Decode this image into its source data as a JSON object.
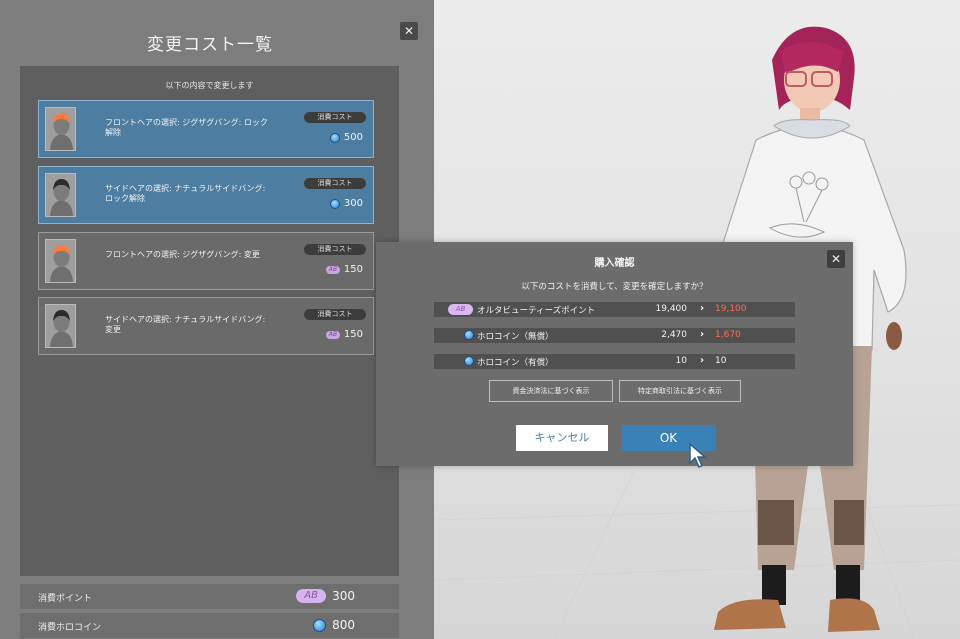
{
  "left_panel": {
    "title": "変更コスト一覧",
    "close_glyph": "✕",
    "caption": "以下の内容で変更します",
    "items": [
      {
        "text": "フロントヘアの選択: ジグザグバング: ロック解除",
        "tag": "消費コスト",
        "currency_icon": "holocoin-icon",
        "price": "500",
        "selected": true,
        "hair_color": "#ff7a3c"
      },
      {
        "text": "サイドヘアの選択: ナチュラルサイドバング: ロック解除",
        "tag": "消費コスト",
        "currency_icon": "holocoin-icon",
        "price": "300",
        "selected": true,
        "hair_color": "#2b2b2b"
      },
      {
        "text": "フロントヘアの選択: ジグザグバング: 変更",
        "tag": "消費コスト",
        "currency_icon": "altabeauties-point-icon",
        "price": "150",
        "selected": false,
        "hair_color": "#ff7a3c"
      },
      {
        "text": "サイドヘアの選択: ナチュラルサイドバング: 変更",
        "tag": "消費コスト",
        "currency_icon": "altabeauties-point-icon",
        "price": "150",
        "selected": false,
        "hair_color": "#2b2b2b"
      }
    ],
    "summary": [
      {
        "label": "消費ポイント",
        "icon": "altabeauties-point-icon",
        "value": "300"
      },
      {
        "label": "消費ホロコイン",
        "icon": "holocoin-icon",
        "value": "800"
      }
    ]
  },
  "dialog": {
    "title": "購入確認",
    "close_glyph": "✕",
    "message": "以下のコストを消費して、変更を確定しますか？",
    "rows": [
      {
        "icon": "altabeauties-point-icon",
        "label": "オルタビューティーズポイント",
        "before": "19,400",
        "arrow": "›",
        "after": "19,100",
        "decrease": true
      },
      {
        "icon": "holocoin-icon",
        "label": "ホロコイン（無償）",
        "before": "2,470",
        "arrow": "›",
        "after": "1,670",
        "decrease": true
      },
      {
        "icon": "holocoin-icon",
        "label": "ホロコイン（有償）",
        "before": "10",
        "arrow": "›",
        "after": "10",
        "decrease": false
      }
    ],
    "law_buttons": [
      "資金決済法に基づく表示",
      "特定商取引法に基づく表示"
    ],
    "cancel_label": "キャンセル",
    "ok_label": "OK"
  },
  "colors": {
    "accent_blue": "#3a81b7",
    "selected_item": "#4d7ea2",
    "decrease_red": "#ff6a5a",
    "point_purple": "#d9b9ee"
  }
}
